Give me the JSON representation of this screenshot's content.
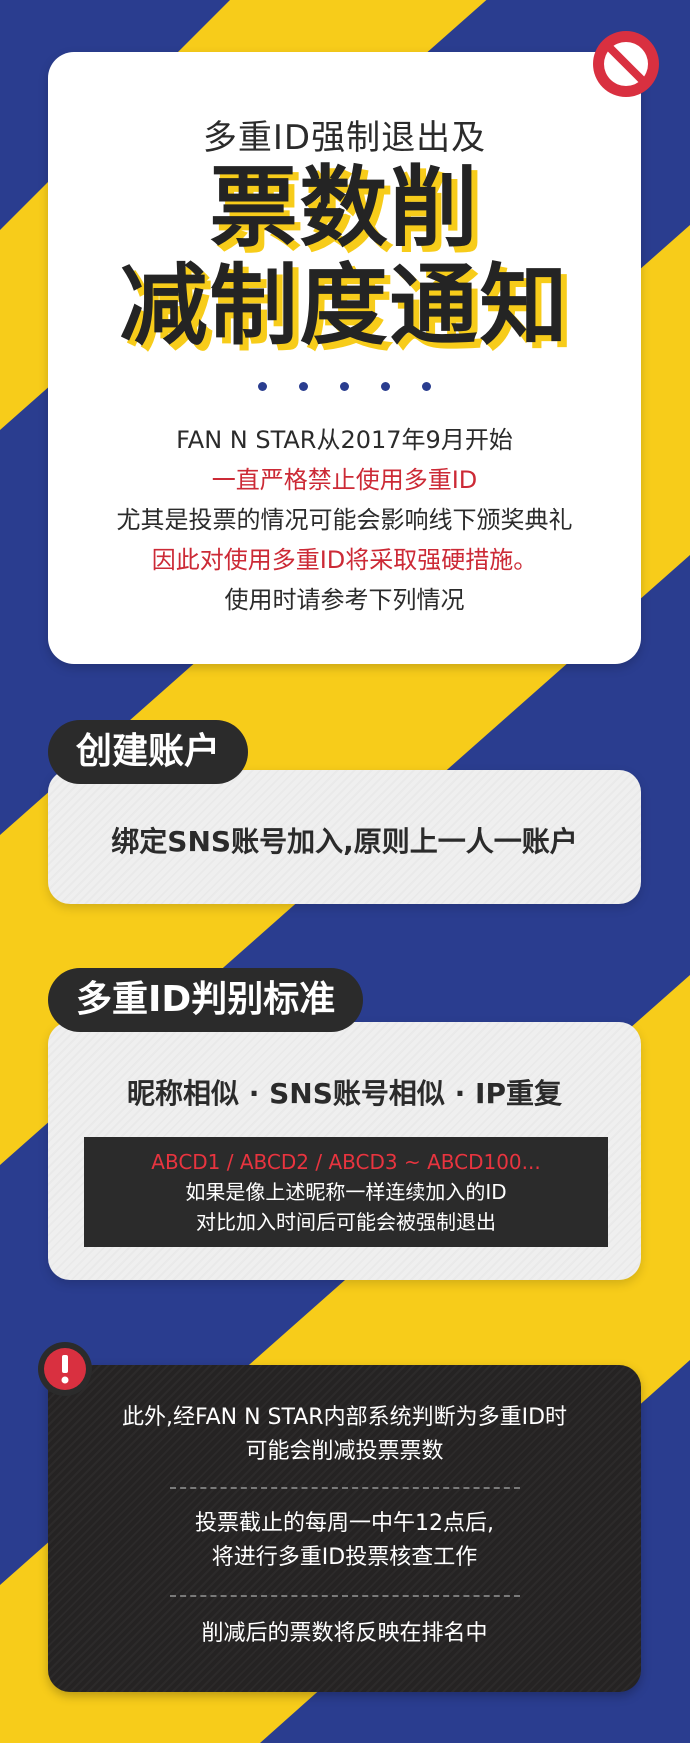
{
  "colors": {
    "navy": "#2a3d8f",
    "yellow": "#f7cc1a",
    "dark": "#2b2b2b",
    "red_text": "#cc2a36",
    "icon_red": "#d93040"
  },
  "header": {
    "subtitle": "多重ID强制退出及",
    "title_line1": "票数削",
    "title_line2": "减制度通知"
  },
  "intro": {
    "lines": [
      "FAN N STAR从2017年9月开始",
      "一直严格禁止使用多重ID",
      "尤其是投票的情况可能会影响线下颁奖典礼",
      "因此对使用多重ID将采取强硬措施。",
      "使用时请参考下列情况"
    ]
  },
  "section1": {
    "label": "创建账户",
    "text": "绑定SNS账号加入,原则上一人一账户"
  },
  "section2": {
    "label": "多重ID判别标准",
    "criteria": "昵称相似 · SNS账号相似 · IP重复",
    "example": "ABCD1 /  ABCD2 / ABCD3 ~ ABCD100...",
    "note_line1": "如果是像上述昵称一样连续加入的ID",
    "note_line2": "对比加入时间后可能会被强制退出"
  },
  "notice": {
    "icon": "exclamation-icon",
    "p1_line1": "此外,经FAN N STAR内部系统判断为多重ID时",
    "p1_line2": "可能会削减投票票数",
    "p2_line1": "投票截止的每周一中午12点后,",
    "p2_line2": "将进行多重ID投票核查工作",
    "p3": "削减后的票数将反映在排名中"
  }
}
